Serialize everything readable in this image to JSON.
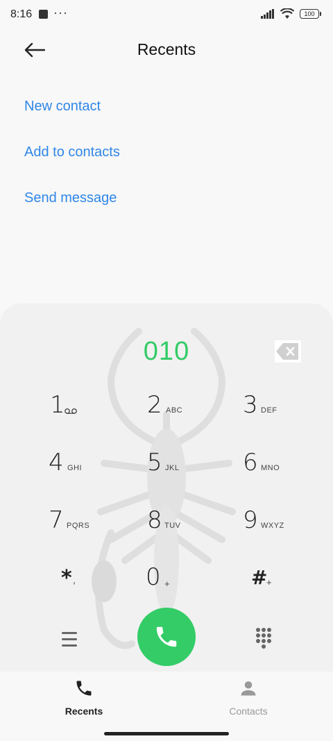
{
  "status_bar": {
    "time": "8:16",
    "more": "···",
    "battery": "100"
  },
  "header": {
    "title": "Recents"
  },
  "actions": [
    "New contact",
    "Add to contacts",
    "Send message"
  ],
  "dialer": {
    "number": "010",
    "keys": [
      {
        "digit": "1",
        "letters": ""
      },
      {
        "digit": "2",
        "letters": "ABC"
      },
      {
        "digit": "3",
        "letters": "DEF"
      },
      {
        "digit": "4",
        "letters": "GHI"
      },
      {
        "digit": "5",
        "letters": "JKL"
      },
      {
        "digit": "6",
        "letters": "MNO"
      },
      {
        "digit": "7",
        "letters": "PQRS"
      },
      {
        "digit": "8",
        "letters": "TUV"
      },
      {
        "digit": "9",
        "letters": "WXYZ"
      },
      {
        "digit": "*",
        "letters": ","
      },
      {
        "digit": "0",
        "letters": "+"
      },
      {
        "digit": "#",
        "letters": "+"
      }
    ],
    "accent_color": "#33cc66"
  },
  "bottom_nav": {
    "recents_label": "Recents",
    "contacts_label": "Contacts"
  },
  "colors": {
    "link": "#2f86e8",
    "call": "#33cc66"
  },
  "icons": [
    "back-arrow-icon",
    "backspace-icon",
    "voicemail-icon",
    "menu-icon",
    "phone-icon",
    "dialpad-icon",
    "person-icon",
    "signal-icon",
    "wifi-icon",
    "battery-icon"
  ]
}
